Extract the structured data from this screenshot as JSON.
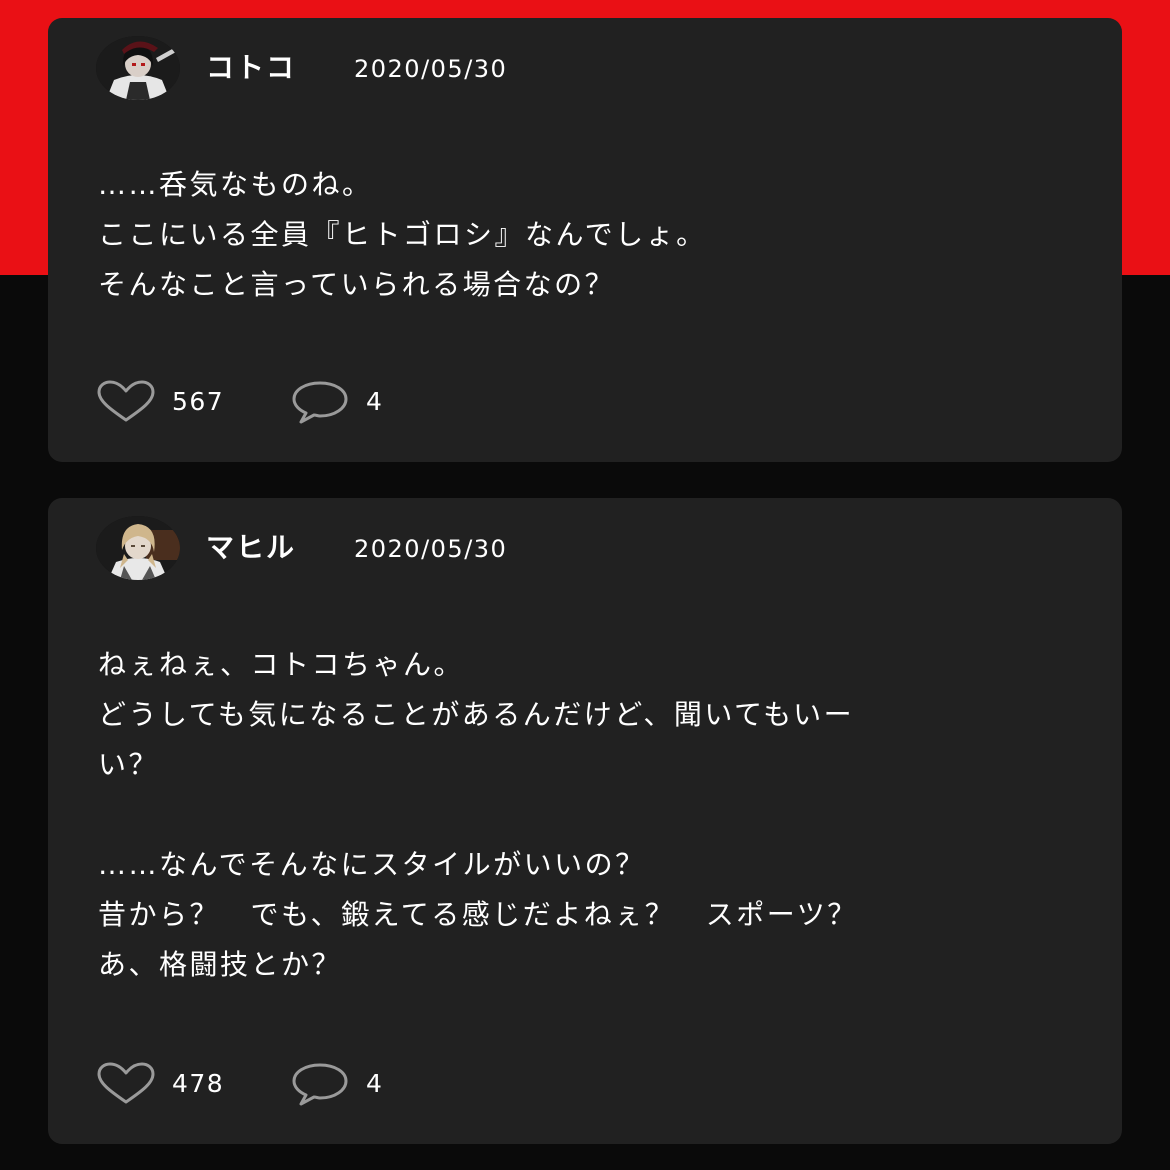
{
  "posts": [
    {
      "username": "コトコ",
      "date": "2020/05/30",
      "avatar": "avatar-kotoko",
      "lines": [
        "……呑気なものね。",
        "ここにいる全員『ヒトゴロシ』なんでしょ。",
        "そんなこと言っていられる場合なの？"
      ],
      "likes": "567",
      "comments": "4"
    },
    {
      "username": "マヒル",
      "date": "2020/05/30",
      "avatar": "avatar-mahiru",
      "lines": [
        "ねぇねぇ、コトコちゃん。",
        "どうしても気になることがあるんだけど、聞いてもいー",
        "い？",
        "",
        "……なんでそんなにスタイルがいいの？",
        "昔から？　でも、鍛えてる感じだよねぇ？　スポーツ？",
        "あ、格闘技とか？"
      ],
      "likes": "478",
      "comments": "4"
    }
  ],
  "colors": {
    "top_band": "#ea1015",
    "background": "#0a0a0a",
    "card": "#212121",
    "text": "#ffffff",
    "icon_stroke": "#9a9a9a"
  },
  "icons": [
    "heart-icon",
    "comment-bubble-icon"
  ]
}
